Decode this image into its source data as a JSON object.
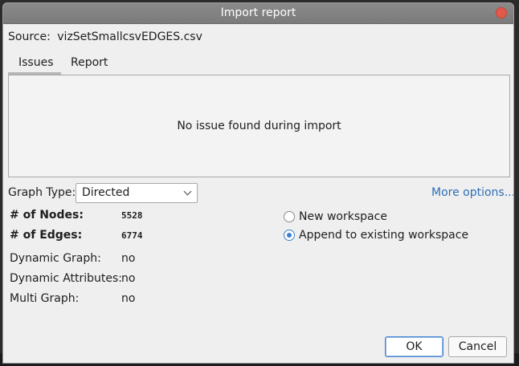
{
  "window": {
    "title": "Import report"
  },
  "source": {
    "label": "Source:",
    "file": "vizSetSmallcsvEDGES.csv"
  },
  "tabs": [
    {
      "label": "Issues",
      "active": true
    },
    {
      "label": "Report",
      "active": false
    }
  ],
  "issues": {
    "message": "No issue found during import"
  },
  "graph_type": {
    "label": "Graph Type:",
    "value": "Directed"
  },
  "more_options": {
    "label": "More options..."
  },
  "stats": {
    "nodes_label": "# of Nodes:",
    "nodes_value": "5528",
    "edges_label": "# of Edges:",
    "edges_value": "6774"
  },
  "properties": [
    {
      "label": "Dynamic Graph:",
      "value": "no"
    },
    {
      "label": "Dynamic Attributes:",
      "value": "no"
    },
    {
      "label": "Multi Graph:",
      "value": "no"
    }
  ],
  "workspace": {
    "options": [
      {
        "label": "New workspace",
        "selected": false
      },
      {
        "label": "Append to existing workspace",
        "selected": true
      }
    ]
  },
  "buttons": {
    "ok": "OK",
    "cancel": "Cancel"
  },
  "colors": {
    "link": "#2e6fb7",
    "radio_selected": "#3d7fd0",
    "close": "#e25a4c",
    "titlebar": "#7b7b7b"
  }
}
